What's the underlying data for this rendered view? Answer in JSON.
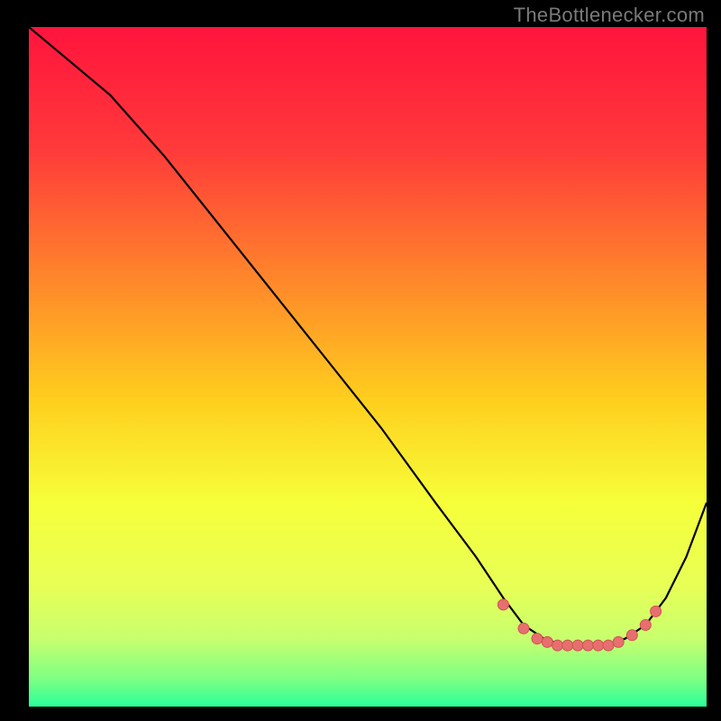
{
  "attribution": "TheBottlenecker.com",
  "colors": {
    "curve_stroke": "#000000",
    "marker_fill": "#e76f6f",
    "marker_stroke": "#cf5454"
  },
  "chart_data": {
    "type": "line",
    "title": "",
    "xlabel": "",
    "ylabel": "",
    "xlim": [
      0,
      100
    ],
    "ylim": [
      0,
      100
    ],
    "grid": false,
    "legend": false,
    "background_gradient": {
      "stops": [
        {
          "offset": 0.0,
          "color": "#ff143d"
        },
        {
          "offset": 0.18,
          "color": "#ff3a3a"
        },
        {
          "offset": 0.38,
          "color": "#ff8a2a"
        },
        {
          "offset": 0.55,
          "color": "#ffcf1e"
        },
        {
          "offset": 0.7,
          "color": "#f6ff3a"
        },
        {
          "offset": 0.82,
          "color": "#e8ff55"
        },
        {
          "offset": 0.9,
          "color": "#c8ff6e"
        },
        {
          "offset": 0.96,
          "color": "#7dff84"
        },
        {
          "offset": 1.0,
          "color": "#2bff9a"
        }
      ]
    },
    "series": [
      {
        "name": "bottleneck-curve",
        "x": [
          0,
          6,
          12,
          20,
          28,
          36,
          44,
          52,
          60,
          66,
          70,
          73,
          76,
          79,
          82,
          85,
          88,
          91,
          94,
          97,
          100
        ],
        "y": [
          100,
          95,
          90,
          81,
          71,
          61,
          51,
          41,
          30,
          22,
          16,
          12,
          10,
          9,
          9,
          9,
          10,
          12,
          16,
          22,
          30
        ]
      }
    ],
    "markers": {
      "name": "highlight-dots",
      "x": [
        70,
        73,
        75,
        76.5,
        78,
        79.5,
        81,
        82.5,
        84,
        85.5,
        87,
        89,
        91,
        92.5
      ],
      "y": [
        15,
        11.5,
        10,
        9.5,
        9,
        9,
        9,
        9,
        9,
        9,
        9.5,
        10.5,
        12,
        14
      ]
    }
  }
}
